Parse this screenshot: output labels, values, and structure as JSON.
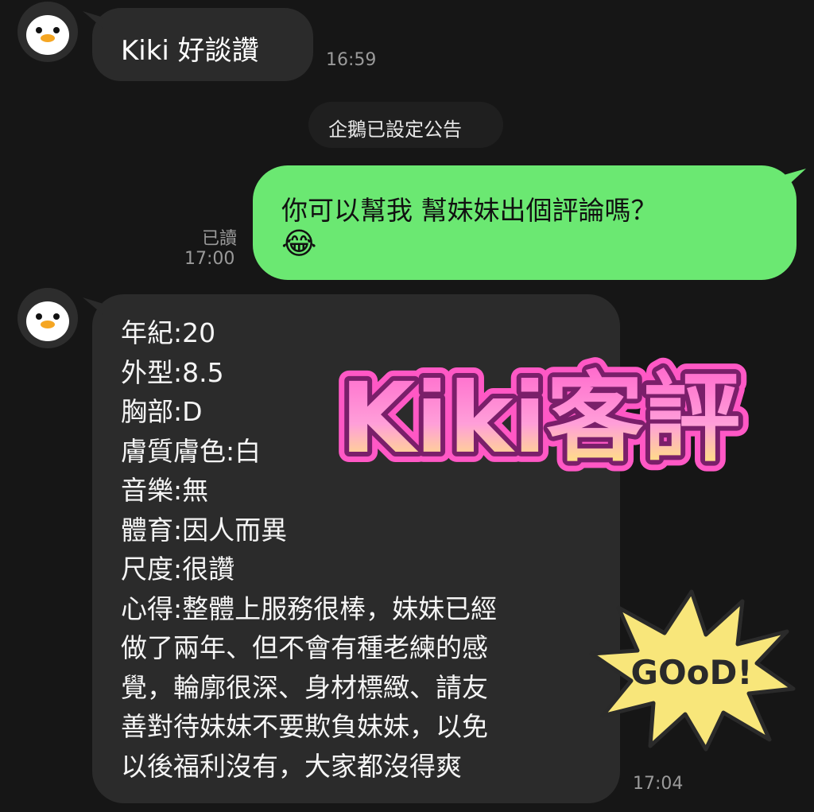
{
  "chat": {
    "message1": {
      "text": "Kiki 好談讚",
      "time": "16:59"
    },
    "system_notice": "企鵝已設定公告",
    "message2": {
      "line1": "你可以幫我 幫妹妹出個評論嗎？",
      "emoji": "😂",
      "read_label": "已讀",
      "time": "17:00"
    },
    "message3": {
      "lines": [
        "年紀:20",
        "外型:8.5",
        "胸部:D",
        "膚質膚色:白",
        "音樂:無",
        "體育:因人而異",
        "尺度:很讚",
        "心得:整體上服務很棒，妹妹已經",
        "做了兩年、但不會有種老練的感",
        "覺，輪廓很深、身材標緻、請友",
        "善對待妹妹不要欺負妹妹，以免",
        "以後福利沒有，大家都沒得爽"
      ],
      "time": "17:04"
    }
  },
  "stickers": {
    "title": "Kiki客評",
    "good": "GOoD!"
  },
  "colors": {
    "background": "#161616",
    "bubble_dark": "#2b2b2b",
    "bubble_green": "#6be872",
    "title_pink": "#ff5cc8"
  }
}
